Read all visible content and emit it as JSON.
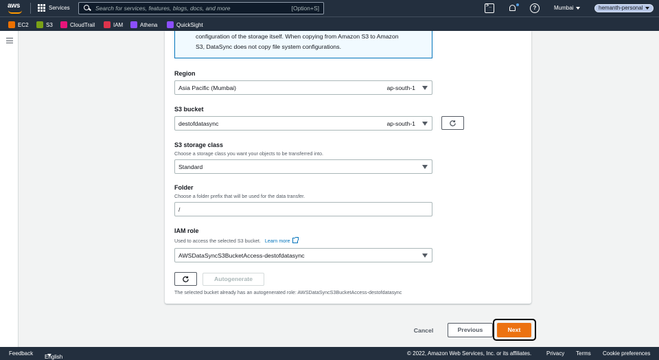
{
  "nav": {
    "logo": "aws",
    "services": "Services",
    "search_placeholder": "Search for services, features, blogs, docs, and more",
    "search_shortcut": "[Option+S]",
    "region": "Mumbai",
    "account": "hemanth-personal"
  },
  "favorites": [
    {
      "label": "EC2",
      "color": "#ed7100"
    },
    {
      "label": "S3",
      "color": "#7aa116"
    },
    {
      "label": "CloudTrail",
      "color": "#e7157b"
    },
    {
      "label": "IAM",
      "color": "#dd344c"
    },
    {
      "label": "Athena",
      "color": "#8c4fff"
    },
    {
      "label": "QuickSight",
      "color": "#8c4fff"
    }
  ],
  "info": {
    "line1": "configuration of the storage itself. When copying from Amazon S3 to Amazon",
    "line2": "S3, DataSync does not copy file system configurations."
  },
  "form": {
    "region_label": "Region",
    "region_value": "Asia Pacific (Mumbai)",
    "region_tag": "ap-south-1",
    "bucket_label": "S3 bucket",
    "bucket_value": "destofdatasync",
    "bucket_tag": "ap-south-1",
    "storage_label": "S3 storage class",
    "storage_desc": "Choose a storage class you want your objects to be transferred into.",
    "storage_value": "Standard",
    "folder_label": "Folder",
    "folder_desc": "Choose a folder prefix that will be used for the data transfer.",
    "folder_value": "/",
    "iam_label": "IAM role",
    "iam_desc": "Used to access the selected S3 bucket.",
    "iam_learn_more": "Learn more",
    "iam_value": "AWSDataSyncS3BucketAccess-destofdatasync",
    "autogenerate": "Autogenerate",
    "autogen_note": "The selected bucket already has an autogenerated role: AWSDataSyncS3BucketAccess-destofdatasync"
  },
  "actions": {
    "cancel": "Cancel",
    "previous": "Previous",
    "next": "Next"
  },
  "footer": {
    "feedback": "Feedback",
    "language": "English (US)",
    "copyright": "© 2022, Amazon Web Services, Inc. or its affiliates.",
    "privacy": "Privacy",
    "terms": "Terms",
    "cookies": "Cookie preferences"
  }
}
